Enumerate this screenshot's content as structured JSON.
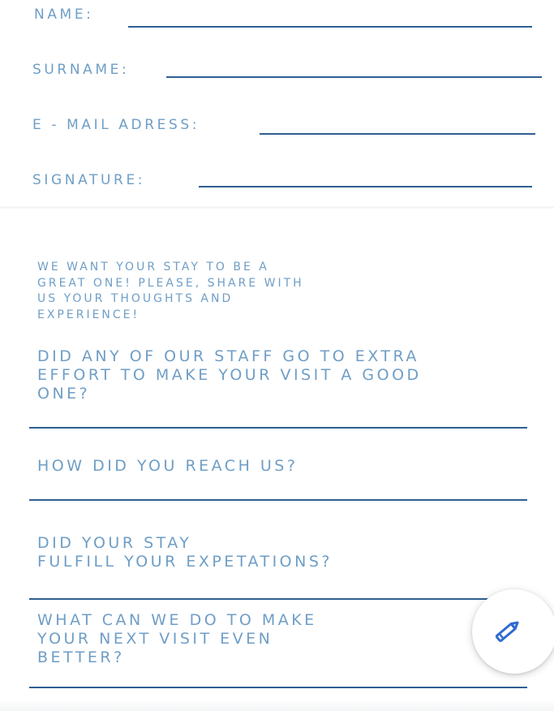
{
  "contact_form": {
    "name_label": "NAME:",
    "surname_label": "SURNAME:",
    "email_label": "E - MAIL ADRESS:",
    "signature_label": "SIGNATURE:"
  },
  "feedback": {
    "intro": "WE WANT YOUR STAY TO BE A\nGREAT ONE! PLEASE, SHARE WITH\nUS YOUR THOUGHTS AND\nEXPERIENCE!",
    "questions": [
      "DID ANY OF OUR STAFF GO TO EXTRA\nEFFORT TO MAKE YOUR VISIT A GOOD\nONE?",
      "HOW DID YOU REACH US?",
      "DID YOUR STAY\nFULFILL YOUR EXPETATIONS?",
      "WHAT CAN WE DO TO MAKE\nYOUR NEXT VISIT EVEN\nBETTER?"
    ]
  },
  "fab": {
    "icon": "pencil-icon",
    "color": "#2f6bd0"
  },
  "colors": {
    "label": "#6f9ec6",
    "line": "#2f5f92",
    "background": "#ffffff"
  }
}
